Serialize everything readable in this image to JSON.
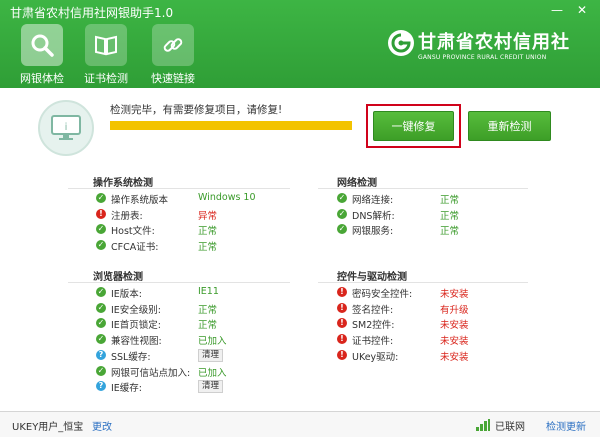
{
  "app": {
    "title": "甘肃省农村信用社网银助手1.0"
  },
  "window": {
    "minimize": "—",
    "close": "✕"
  },
  "nav": [
    {
      "label": "网银体检",
      "icon": "magnifier-icon"
    },
    {
      "label": "证书检测",
      "icon": "book-icon"
    },
    {
      "label": "快速链接",
      "icon": "link-icon"
    }
  ],
  "brand": {
    "name": "甘肃省农村信用社",
    "english": "GANSU PROVINCE RURAL CREDIT UNION"
  },
  "check": {
    "message": "检测完毕，有需要修复项目，请修复!",
    "progress": 1.0,
    "fix_button": "一键修复",
    "recheck_button": "重新检测"
  },
  "sections": {
    "os": {
      "title": "操作系统检测",
      "items": [
        {
          "status": "ok",
          "label": "操作系统版本",
          "value": "Windows 10",
          "value_status": "ok"
        },
        {
          "status": "err",
          "label": "注册表:",
          "value": "异常",
          "value_status": "err"
        },
        {
          "status": "ok",
          "label": "Host文件:",
          "value": "正常",
          "value_status": "ok"
        },
        {
          "status": "ok",
          "label": "CFCA证书:",
          "value": "正常",
          "value_status": "ok"
        }
      ]
    },
    "network": {
      "title": "网络检测",
      "items": [
        {
          "status": "ok",
          "label": "网络连接:",
          "value": "正常",
          "value_status": "ok"
        },
        {
          "status": "ok",
          "label": "DNS解析:",
          "value": "正常",
          "value_status": "ok"
        },
        {
          "status": "ok",
          "label": "网银服务:",
          "value": "正常",
          "value_status": "ok"
        }
      ]
    },
    "browser": {
      "title": "浏览器检测",
      "items": [
        {
          "status": "ok",
          "label": "IE版本:",
          "value": "IE11",
          "value_status": "ok"
        },
        {
          "status": "ok",
          "label": "IE安全级别:",
          "value": "正常",
          "value_status": "ok"
        },
        {
          "status": "ok",
          "label": "IE首页锁定:",
          "value": "正常",
          "value_status": "ok"
        },
        {
          "status": "ok",
          "label": "兼容性视图:",
          "value": "已加入",
          "value_status": "ok"
        },
        {
          "status": "info",
          "label": "SSL缓存:",
          "value": "清理",
          "value_status": "btn"
        },
        {
          "status": "ok",
          "label": "网银可信站点加入:",
          "value": "已加入",
          "value_status": "ok"
        },
        {
          "status": "info",
          "label": "IE缓存:",
          "value": "清理",
          "value_status": "btn"
        }
      ]
    },
    "drivers": {
      "title": "控件与驱动检测",
      "items": [
        {
          "status": "err",
          "label": "密码安全控件:",
          "value": "未安装",
          "value_status": "err"
        },
        {
          "status": "err",
          "label": "签名控件:",
          "value": "有升级",
          "value_status": "err"
        },
        {
          "status": "err",
          "label": "SM2控件:",
          "value": "未安装",
          "value_status": "err"
        },
        {
          "status": "err",
          "label": "证书控件:",
          "value": "未安装",
          "value_status": "err"
        },
        {
          "status": "err",
          "label": "UKey驱动:",
          "value": "未安装",
          "value_status": "err"
        }
      ]
    }
  },
  "statusbar": {
    "user": "UKEY用户_恒宝",
    "change": "更改",
    "network": "已联网",
    "update": "检测更新"
  },
  "colors": {
    "brand_green": "#35a93c",
    "ok": "#3a9a2a",
    "error": "#d9251c",
    "progress": "#f3c300"
  }
}
